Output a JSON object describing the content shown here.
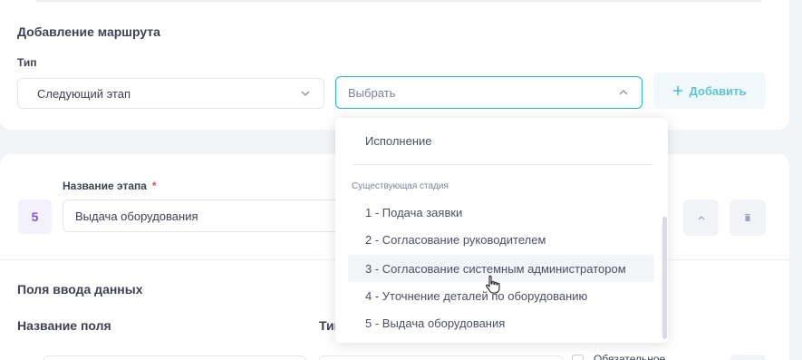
{
  "route_section": {
    "title": "Добавление маршрута",
    "type_label": "Тип",
    "type_value": "Следующий этап",
    "choose_placeholder": "Выбрать",
    "add_button": "Добавить",
    "add_icon": "plus-icon"
  },
  "dropdown": {
    "first_option": "Исполнение",
    "group_label": "Существующая стадия",
    "options": [
      "1 - Подача заявки",
      "2 - Согласование руководителем",
      "3 - Согласование системным администратором",
      "4 - Уточнение деталей по оборудованию",
      "5 - Выдача оборудования"
    ],
    "hovered_index": 2
  },
  "stage": {
    "number": "5",
    "name_label": "Название этапа",
    "required_mark": "*",
    "name_value": "Выдача оборудования"
  },
  "fields_section": {
    "title": "Поля ввода данных",
    "col_name": "Название поля",
    "col_type": "Тип",
    "required_checkbox_label": "Обязательное"
  },
  "colors": {
    "accent": "#2ab8c8",
    "add_text": "#5fc4d6",
    "stage_num": "#7d58d4",
    "required": "#f1416c"
  }
}
